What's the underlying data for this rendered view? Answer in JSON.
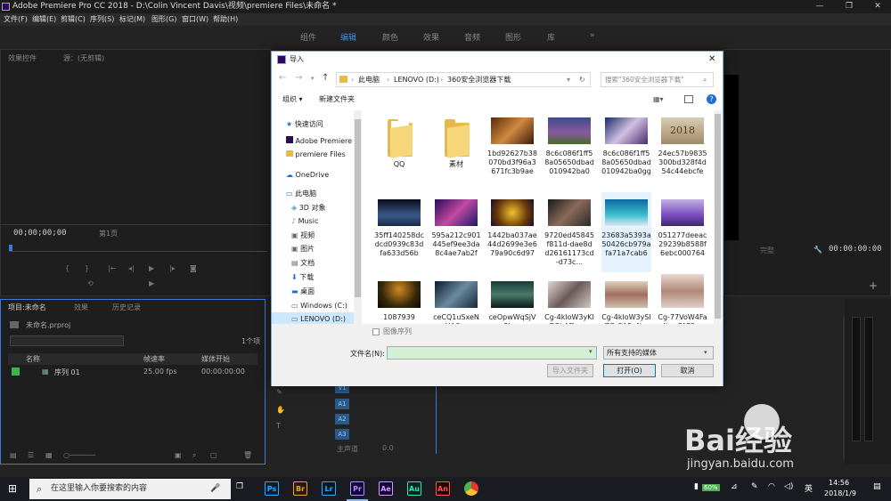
{
  "window": {
    "title": "Adobe Premiere Pro CC 2018 - D:\\Colin Vincent Davis\\视频\\premiere Files\\未命名 *"
  },
  "menu": [
    "文件(F)",
    "编辑(E)",
    "剪辑(C)",
    "序列(S)",
    "标记(M)",
    "图形(G)",
    "窗口(W)",
    "帮助(H)"
  ],
  "workspaces": [
    "组件",
    "编辑",
    "颜色",
    "效果",
    "音频",
    "图形",
    "库"
  ],
  "active_workspace": "编辑",
  "source_panel": {
    "tabs": [
      "效果控件",
      "源：(无剪辑)"
    ],
    "timecode_left": "00;00;00;00",
    "page_label": "第1页"
  },
  "program_panel": {
    "timecode_right": "00:00:00:00",
    "fit_label": "完整"
  },
  "project_panel": {
    "tabs": [
      "项目:未命名",
      "效果",
      "历史记录"
    ],
    "file": "未命名.prproj",
    "item_count": "1个项",
    "columns": [
      "名称",
      "帧速率",
      "媒体开始"
    ],
    "rows": [
      {
        "name": "序列 01",
        "fps": "25.00 fps",
        "start": "00:00:00:00"
      }
    ]
  },
  "timeline": {
    "tracks": [
      "V1",
      "A1",
      "A2",
      "A3"
    ],
    "master": "主声道",
    "master_value": "0.0"
  },
  "dialog": {
    "title": "导入",
    "breadcrumb": [
      "此电脑",
      "LENOVO (D:)",
      "360安全浏览器下载"
    ],
    "search_placeholder": "搜索\"360安全浏览器下载\"",
    "organize": "组织 ▾",
    "new_folder": "新建文件夹",
    "nav": [
      {
        "label": "快速访问",
        "icon": "star-icon"
      },
      {
        "label": "Adobe Premiere",
        "icon": "premiere-icon"
      },
      {
        "label": "premiere Files",
        "icon": "folder-icon"
      },
      {
        "label": "OneDrive",
        "icon": "cloud-icon"
      },
      {
        "label": "此电脑",
        "icon": "computer-icon"
      },
      {
        "label": "3D 对象",
        "icon": "cube-icon"
      },
      {
        "label": "Music",
        "icon": "music-icon"
      },
      {
        "label": "视频",
        "icon": "video-icon"
      },
      {
        "label": "图片",
        "icon": "picture-icon"
      },
      {
        "label": "文档",
        "icon": "document-icon"
      },
      {
        "label": "下载",
        "icon": "download-icon"
      },
      {
        "label": "桌面",
        "icon": "desktop-icon"
      },
      {
        "label": "Windows (C:)",
        "icon": "drive-icon"
      },
      {
        "label": "LENOVO (D:)",
        "icon": "drive-icon"
      }
    ],
    "files": [
      {
        "name": "QQ",
        "kind": "folder"
      },
      {
        "name": "素材",
        "kind": "folder"
      },
      {
        "name": "1bd92627b38070bd3f96a3671fc3b9ae",
        "kind": "image",
        "color": "#8a4a1f"
      },
      {
        "name": "8c6c086f1ff58a05650dbad010942ba0",
        "kind": "image",
        "color": "#6a4a7a"
      },
      {
        "name": "8c6c086f1ff58a05650dbad010942ba0gg",
        "kind": "image",
        "color": "#5a4a7a"
      },
      {
        "name": "24ec57b9835300bd328f4d54c44ebcfe",
        "kind": "image",
        "color": "#c9b89a"
      },
      {
        "name": "35ff140258dcdcd0939c83dfa633d56b",
        "kind": "image",
        "color": "#2a3d5a"
      },
      {
        "name": "595a212c901445ef9ee3da8c4ae7ab2f",
        "kind": "image",
        "color": "#5a2a7a"
      },
      {
        "name": "1442ba037ae44d2699e3e679a90c6d97",
        "kind": "image",
        "color": "#c8921a"
      },
      {
        "name": "9720ed45845f811d-dae8dd26161173cd-d73c...",
        "kind": "image",
        "color": "#3a3030"
      },
      {
        "name": "23683a5393a50426cb979afa71a7cab6",
        "kind": "image",
        "color": "#1e8ab0"
      },
      {
        "name": "051277deeac29239b8588f6ebc000764",
        "kind": "image",
        "color": "#9a7ad0"
      },
      {
        "name": "1087939",
        "kind": "image",
        "color": "#6a4a1a"
      },
      {
        "name": "ceCQ1uSxeNHAO...",
        "kind": "image",
        "color": "#2a3a4a"
      },
      {
        "name": "ceOpwWqSjV8Jo...",
        "kind": "image",
        "color": "#3a5a5a"
      },
      {
        "name": "Cg-4kloW3yKID3hAFiys...",
        "kind": "image",
        "color": "#b0a8a0"
      },
      {
        "name": "Cg-4kloW3ySIZC_SAFy4l...",
        "kind": "image",
        "color": "#c0a090"
      },
      {
        "name": "Cg-77VoW4FaIJsmFAF3...",
        "kind": "image",
        "color": "#c9a8a0"
      }
    ],
    "thumb_text_2018": "2018",
    "image_sequence": "图像序列",
    "filename_label": "文件名(N):",
    "filename_value": "",
    "filter": "所有支持的媒体",
    "import_folder": "导入文件夹",
    "open": "打开(O)",
    "cancel": "取消"
  },
  "taskbar": {
    "search_placeholder": "在这里输入你要搜索的内容",
    "apps": [
      "Ps",
      "Br",
      "Lr",
      "Pr",
      "Ae",
      "Au",
      "An"
    ],
    "battery": "60%",
    "time": "14:56",
    "date": "2018/1/9"
  },
  "watermark": {
    "text": "Bai经验",
    "url": "jingyan.baidu.com"
  }
}
